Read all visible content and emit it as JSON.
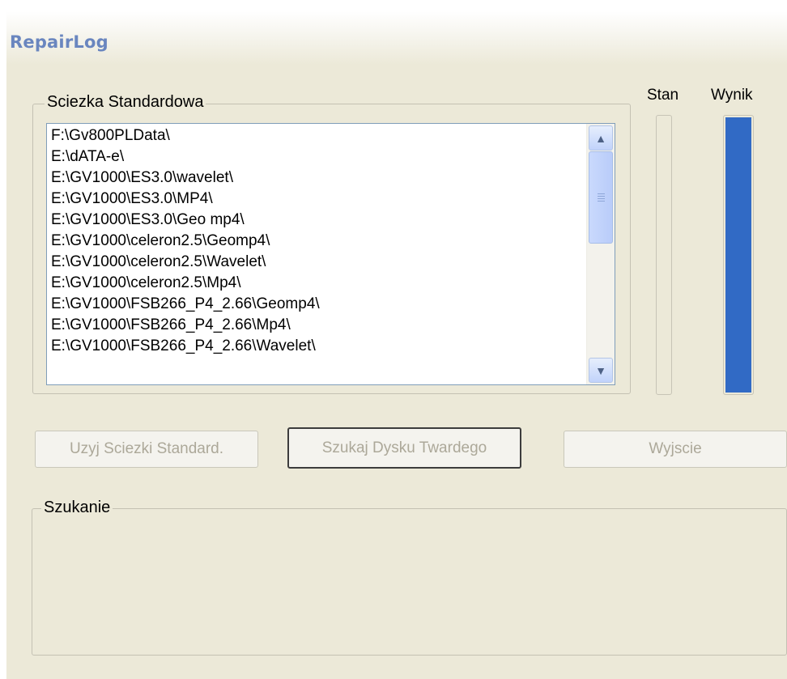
{
  "window": {
    "title": "RepairLog"
  },
  "standard_path_group": {
    "legend": "Sciezka Standardowa",
    "paths": [
      "F:\\Gv800PLData\\",
      "E:\\dATA-e\\",
      "E:\\GV1000\\ES3.0\\wavelet\\",
      "E:\\GV1000\\ES3.0\\MP4\\",
      "E:\\GV1000\\ES3.0\\Geo mp4\\",
      "E:\\GV1000\\celeron2.5\\Geomp4\\",
      "E:\\GV1000\\celeron2.5\\Wavelet\\",
      "E:\\GV1000\\celeron2.5\\Mp4\\",
      "E:\\GV1000\\FSB266_P4_2.66\\Geomp4\\",
      "E:\\GV1000\\FSB266_P4_2.66\\Mp4\\",
      "E:\\GV1000\\FSB266_P4_2.66\\Wavelet\\"
    ]
  },
  "status": {
    "stan_label": "Stan",
    "wynik_label": "Wynik",
    "stan_progress": 0.0,
    "wynik_progress": 1.0,
    "fill_color": "#316ac5"
  },
  "buttons": {
    "use_standard": "Uzyj Sciezki Standard.",
    "search_disk": "Szukaj Dysku Twardego",
    "exit": "Wyjscie"
  },
  "search_group": {
    "legend": "Szukanie"
  }
}
